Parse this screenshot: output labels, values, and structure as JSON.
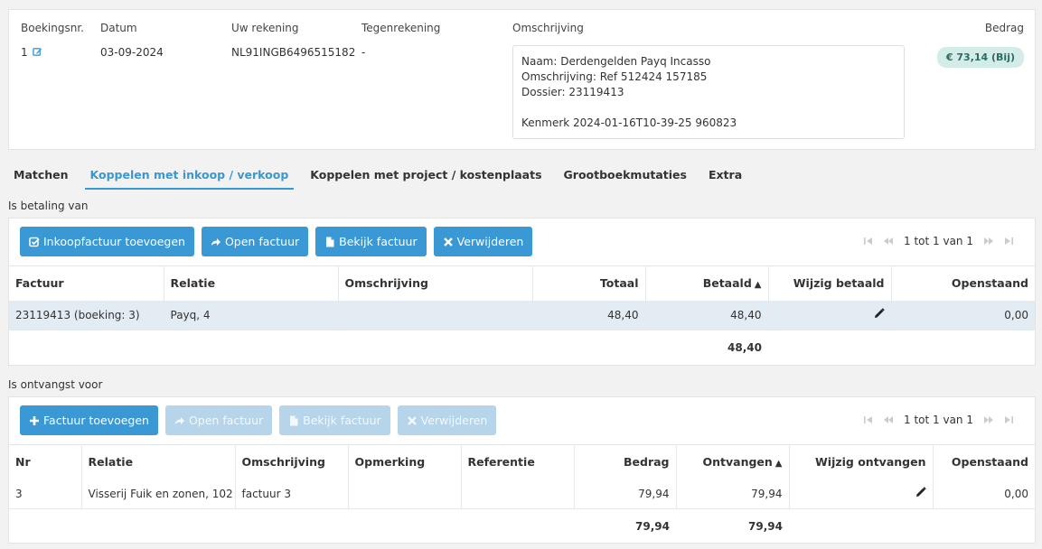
{
  "header": {
    "labels": {
      "booking_nr": "Boekingsnr.",
      "date": "Datum",
      "account": "Uw rekening",
      "counter_account": "Tegenrekening",
      "description": "Omschrijving",
      "amount": "Bedrag"
    },
    "values": {
      "booking_nr": "1",
      "date": "03-09-2024",
      "account": "NL91INGB6496515182",
      "counter_account": "-",
      "description_lines": [
        "Naam: Derdengelden Payq Incasso",
        "Omschrijving: Ref 512424 157185",
        "Dossier: 23119413",
        "",
        "Kenmerk 2024-01-16T10-39-25 960823"
      ],
      "amount_badge": "€ 73,14 (Bij)"
    }
  },
  "tabs": [
    {
      "label": "Matchen"
    },
    {
      "label": "Koppelen met inkoop / verkoop"
    },
    {
      "label": "Koppelen met project / kostenplaats"
    },
    {
      "label": "Grootboekmutaties"
    },
    {
      "label": "Extra"
    }
  ],
  "payment": {
    "title": "Is betaling van",
    "buttons": {
      "add": "Inkoopfactuur toevoegen",
      "open": "Open factuur",
      "view": "Bekijk factuur",
      "remove": "Verwijderen"
    },
    "pager": "1 tot 1 van 1",
    "columns": [
      "Factuur",
      "Relatie",
      "Omschrijving",
      "Totaal",
      "Betaald",
      "Wijzig betaald",
      "Openstaand"
    ],
    "sort_indicator": "▲",
    "rows": [
      {
        "invoice": "23119413 (boeking: 3)",
        "relation": "Payq, 4",
        "description": "",
        "total": "48,40",
        "paid": "48,40",
        "outstanding": "0,00"
      }
    ],
    "total_paid": "48,40"
  },
  "receipt": {
    "title": "Is ontvangst voor",
    "buttons": {
      "add": "Factuur toevoegen",
      "open": "Open factuur",
      "view": "Bekijk factuur",
      "remove": "Verwijderen"
    },
    "pager": "1 tot 1 van 1",
    "columns": [
      "Nr",
      "Relatie",
      "Omschrijving",
      "Opmerking",
      "Referentie",
      "Bedrag",
      "Ontvangen",
      "Wijzig ontvangen",
      "Openstaand"
    ],
    "sort_indicator": "▲",
    "rows": [
      {
        "nr": "3",
        "relation": "Visserij Fuik en zonen, 102",
        "description": "factuur 3",
        "remark": "",
        "reference": "",
        "amount": "79,94",
        "received": "79,94",
        "outstanding": "0,00"
      }
    ],
    "total_amount": "79,94",
    "total_received": "79,94"
  },
  "colors": {
    "accent": "#3a98d4",
    "badge_bg": "#d4ece8",
    "badge_text": "#2c6b60",
    "selected_row": "#e3ebf3"
  }
}
